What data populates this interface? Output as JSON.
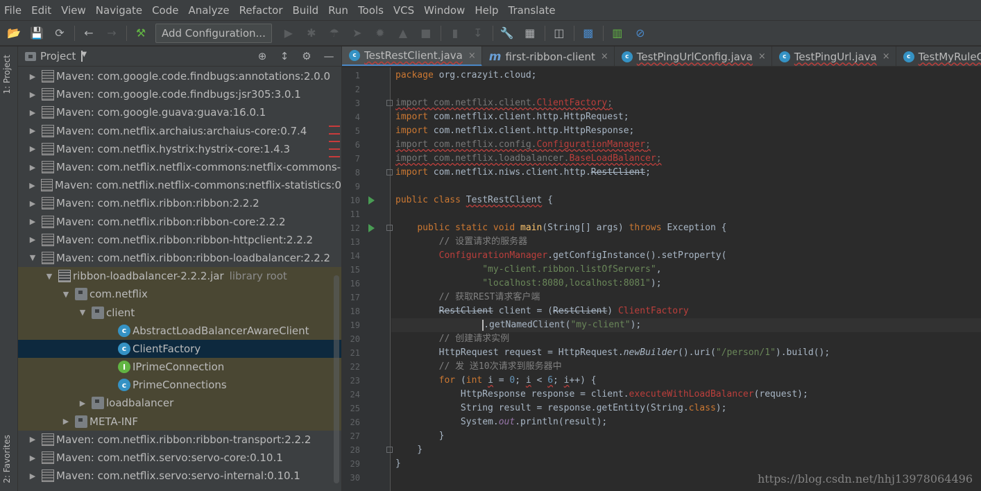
{
  "menu": [
    "File",
    "Edit",
    "View",
    "Navigate",
    "Code",
    "Analyze",
    "Refactor",
    "Build",
    "Run",
    "Tools",
    "VCS",
    "Window",
    "Help",
    "Translate"
  ],
  "toolbar": {
    "config_label": "Add Configuration..."
  },
  "stripe": {
    "project_tab": "1: Project",
    "favorites_tab": "2: Favorites"
  },
  "project": {
    "title": "Project",
    "tree": [
      {
        "label": "Maven: com.google.code.findbugs:annotations:2.0.0",
        "kind": "maven",
        "level": 0,
        "arrow": "right"
      },
      {
        "label": "Maven: com.google.code.findbugs:jsr305:3.0.1",
        "kind": "maven",
        "level": 0,
        "arrow": "right"
      },
      {
        "label": "Maven: com.google.guava:guava:16.0.1",
        "kind": "maven",
        "level": 0,
        "arrow": "right"
      },
      {
        "label": "Maven: com.netflix.archaius:archaius-core:0.7.4",
        "kind": "maven",
        "level": 0,
        "arrow": "right"
      },
      {
        "label": "Maven: com.netflix.hystrix:hystrix-core:1.4.3",
        "kind": "maven",
        "level": 0,
        "arrow": "right"
      },
      {
        "label": "Maven: com.netflix.netflix-commons:netflix-commons-",
        "kind": "maven",
        "level": 0,
        "arrow": "right"
      },
      {
        "label": "Maven: com.netflix.netflix-commons:netflix-statistics:0",
        "kind": "maven",
        "level": 0,
        "arrow": "right"
      },
      {
        "label": "Maven: com.netflix.ribbon:ribbon:2.2.2",
        "kind": "maven",
        "level": 0,
        "arrow": "right"
      },
      {
        "label": "Maven: com.netflix.ribbon:ribbon-core:2.2.2",
        "kind": "maven",
        "level": 0,
        "arrow": "right"
      },
      {
        "label": "Maven: com.netflix.ribbon:ribbon-httpclient:2.2.2",
        "kind": "maven",
        "level": 0,
        "arrow": "right"
      },
      {
        "label": "Maven: com.netflix.ribbon:ribbon-loadbalancer:2.2.2",
        "kind": "maven",
        "level": 0,
        "arrow": "down"
      },
      {
        "label": "ribbon-loadbalancer-2.2.2.jar",
        "sub": "library root",
        "kind": "jar",
        "level": 1,
        "arrow": "down",
        "bg": "jar"
      },
      {
        "label": "com.netflix",
        "kind": "pkg",
        "level": 2,
        "arrow": "down",
        "bg": "jar"
      },
      {
        "label": "client",
        "kind": "pkg",
        "level": 3,
        "arrow": "down",
        "bg": "jar"
      },
      {
        "label": "AbstractLoadBalancerAwareClient",
        "kind": "class",
        "level": 4,
        "arrow": "",
        "bg": "jar"
      },
      {
        "label": "ClientFactory",
        "kind": "class",
        "level": 4,
        "arrow": "",
        "bg": "selected"
      },
      {
        "label": "IPrimeConnection",
        "kind": "iface",
        "level": 4,
        "arrow": "",
        "bg": "jar"
      },
      {
        "label": "PrimeConnections",
        "kind": "class",
        "level": 4,
        "arrow": "",
        "bg": "jar"
      },
      {
        "label": "loadbalancer",
        "kind": "pkg",
        "level": 3,
        "arrow": "right",
        "bg": "jar"
      },
      {
        "label": "META-INF",
        "kind": "pkg",
        "level": 2,
        "arrow": "right",
        "bg": "jar"
      },
      {
        "label": "Maven: com.netflix.ribbon:ribbon-transport:2.2.2",
        "kind": "maven",
        "level": 0,
        "arrow": "right"
      },
      {
        "label": "Maven: com.netflix.servo:servo-core:0.10.1",
        "kind": "maven",
        "level": 0,
        "arrow": "right"
      },
      {
        "label": "Maven: com.netflix.servo:servo-internal:0.10.1",
        "kind": "maven",
        "level": 0,
        "arrow": "right"
      }
    ]
  },
  "tabs": [
    {
      "label": "TestRestClient.java",
      "icon": "class",
      "active": true,
      "wavy": true
    },
    {
      "label": "first-ribbon-client",
      "icon": "maven-m",
      "active": false,
      "wavy": false
    },
    {
      "label": "TestPingUrlConfig.java",
      "icon": "class",
      "active": false,
      "wavy": true
    },
    {
      "label": "TestPingUrl.java",
      "icon": "class",
      "active": false,
      "wavy": true
    },
    {
      "label": "TestMyRuleC",
      "icon": "class",
      "active": false,
      "wavy": true
    }
  ],
  "code": {
    "line_numbers": [
      "1",
      "2",
      "3",
      "4",
      "5",
      "6",
      "7",
      "8",
      "9",
      "10",
      "11",
      "12",
      "13",
      "14",
      "15",
      "16",
      "17",
      "18",
      "19",
      "20",
      "21",
      "22",
      "23",
      "24",
      "25",
      "26",
      "27",
      "28",
      "29",
      "30"
    ],
    "lines": [
      [
        {
          "t": "package ",
          "c": "kw"
        },
        {
          "t": "org.crazyit.cloud;"
        }
      ],
      [],
      [
        {
          "t": "import com.netflix.client.",
          "c": "dim wavy"
        },
        {
          "t": "ClientFactory",
          "c": "err wavy"
        },
        {
          "t": ";",
          "c": "dim wavy"
        }
      ],
      [
        {
          "t": "import ",
          "c": "kw"
        },
        {
          "t": "com.netflix.client.http.HttpRequest;"
        }
      ],
      [
        {
          "t": "import ",
          "c": "kw"
        },
        {
          "t": "com.netflix.client.http.HttpResponse;"
        }
      ],
      [
        {
          "t": "import com.netflix.config.",
          "c": "dim wavy"
        },
        {
          "t": "ConfigurationManager",
          "c": "err wavy"
        },
        {
          "t": ";",
          "c": "dim wavy"
        }
      ],
      [
        {
          "t": "import com.netflix.loadbalancer.",
          "c": "dim wavy"
        },
        {
          "t": "BaseLoadBalancer",
          "c": "err wavy"
        },
        {
          "t": ";",
          "c": "dim wavy"
        }
      ],
      [
        {
          "t": "import ",
          "c": "kw"
        },
        {
          "t": "com.netflix.niws.client.http."
        },
        {
          "t": "RestClient",
          "c": "strike"
        },
        {
          "t": ";"
        }
      ],
      [],
      [
        {
          "t": "public class ",
          "c": "kw"
        },
        {
          "t": "TestRestClient",
          "c": "wavy"
        },
        {
          "t": " {"
        }
      ],
      [],
      [
        {
          "t": "    "
        },
        {
          "t": "public static void ",
          "c": "kw"
        },
        {
          "t": "main",
          "c": "fn"
        },
        {
          "t": "(String[] args) "
        },
        {
          "t": "throws ",
          "c": "kw"
        },
        {
          "t": "Exception {"
        }
      ],
      [
        {
          "t": "        // 设置请求的服务器",
          "c": "cmt"
        }
      ],
      [
        {
          "t": "        "
        },
        {
          "t": "ConfigurationManager",
          "c": "err"
        },
        {
          "t": ".getConfigInstance().setProperty("
        }
      ],
      [
        {
          "t": "                "
        },
        {
          "t": "\"my-client.ribbon.listOfServers\"",
          "c": "str"
        },
        {
          "t": ","
        }
      ],
      [
        {
          "t": "                "
        },
        {
          "t": "\"localhost:8080,localhost:8081\"",
          "c": "str"
        },
        {
          "t": ");"
        }
      ],
      [
        {
          "t": "        // 获取REST请求客户端",
          "c": "cmt"
        }
      ],
      [
        {
          "t": "        "
        },
        {
          "t": "RestClient",
          "c": "strike"
        },
        {
          "t": " client = ("
        },
        {
          "t": "RestClient",
          "c": "strike"
        },
        {
          "t": ") "
        },
        {
          "t": "ClientFactory",
          "c": "err"
        }
      ],
      [
        {
          "t": "                "
        },
        {
          "t": "",
          "c": "caret"
        },
        {
          "t": ".getNamedClient("
        },
        {
          "t": "\"my-client\"",
          "c": "str"
        },
        {
          "t": ");"
        }
      ],
      [
        {
          "t": "        // 创建请求实例",
          "c": "cmt"
        }
      ],
      [
        {
          "t": "        HttpRequest request = HttpRequest."
        },
        {
          "t": "newBuilder",
          "c": "italic"
        },
        {
          "t": "().uri("
        },
        {
          "t": "\"/person/1\"",
          "c": "str"
        },
        {
          "t": ").build();"
        }
      ],
      [
        {
          "t": "        // 发 送10次请求到服务器中",
          "c": "cmt"
        }
      ],
      [
        {
          "t": "        "
        },
        {
          "t": "for ",
          "c": "kw"
        },
        {
          "t": "("
        },
        {
          "t": "int ",
          "c": "kw"
        },
        {
          "t": "i",
          "c": "wavy"
        },
        {
          "t": " = "
        },
        {
          "t": "0",
          "c": "num"
        },
        {
          "t": "; "
        },
        {
          "t": "i",
          "c": "wavy"
        },
        {
          "t": " < "
        },
        {
          "t": "6",
          "c": "num wavy"
        },
        {
          "t": "; "
        },
        {
          "t": "i",
          "c": "wavy"
        },
        {
          "t": "++) {"
        }
      ],
      [
        {
          "t": "            HttpResponse response = client."
        },
        {
          "t": "executeWithLoadBalancer",
          "c": "err"
        },
        {
          "t": "(request);"
        }
      ],
      [
        {
          "t": "            String result = response.getEntity(String."
        },
        {
          "t": "class",
          "c": "kw"
        },
        {
          "t": ");"
        }
      ],
      [
        {
          "t": "            System."
        },
        {
          "t": "out",
          "c": "fld italic"
        },
        {
          "t": ".println(result);"
        }
      ],
      [
        {
          "t": "        }"
        }
      ],
      [
        {
          "t": "    }"
        }
      ],
      [
        {
          "t": "}"
        }
      ],
      []
    ]
  },
  "watermark": "https://blog.csdn.net/hhj13978064496"
}
